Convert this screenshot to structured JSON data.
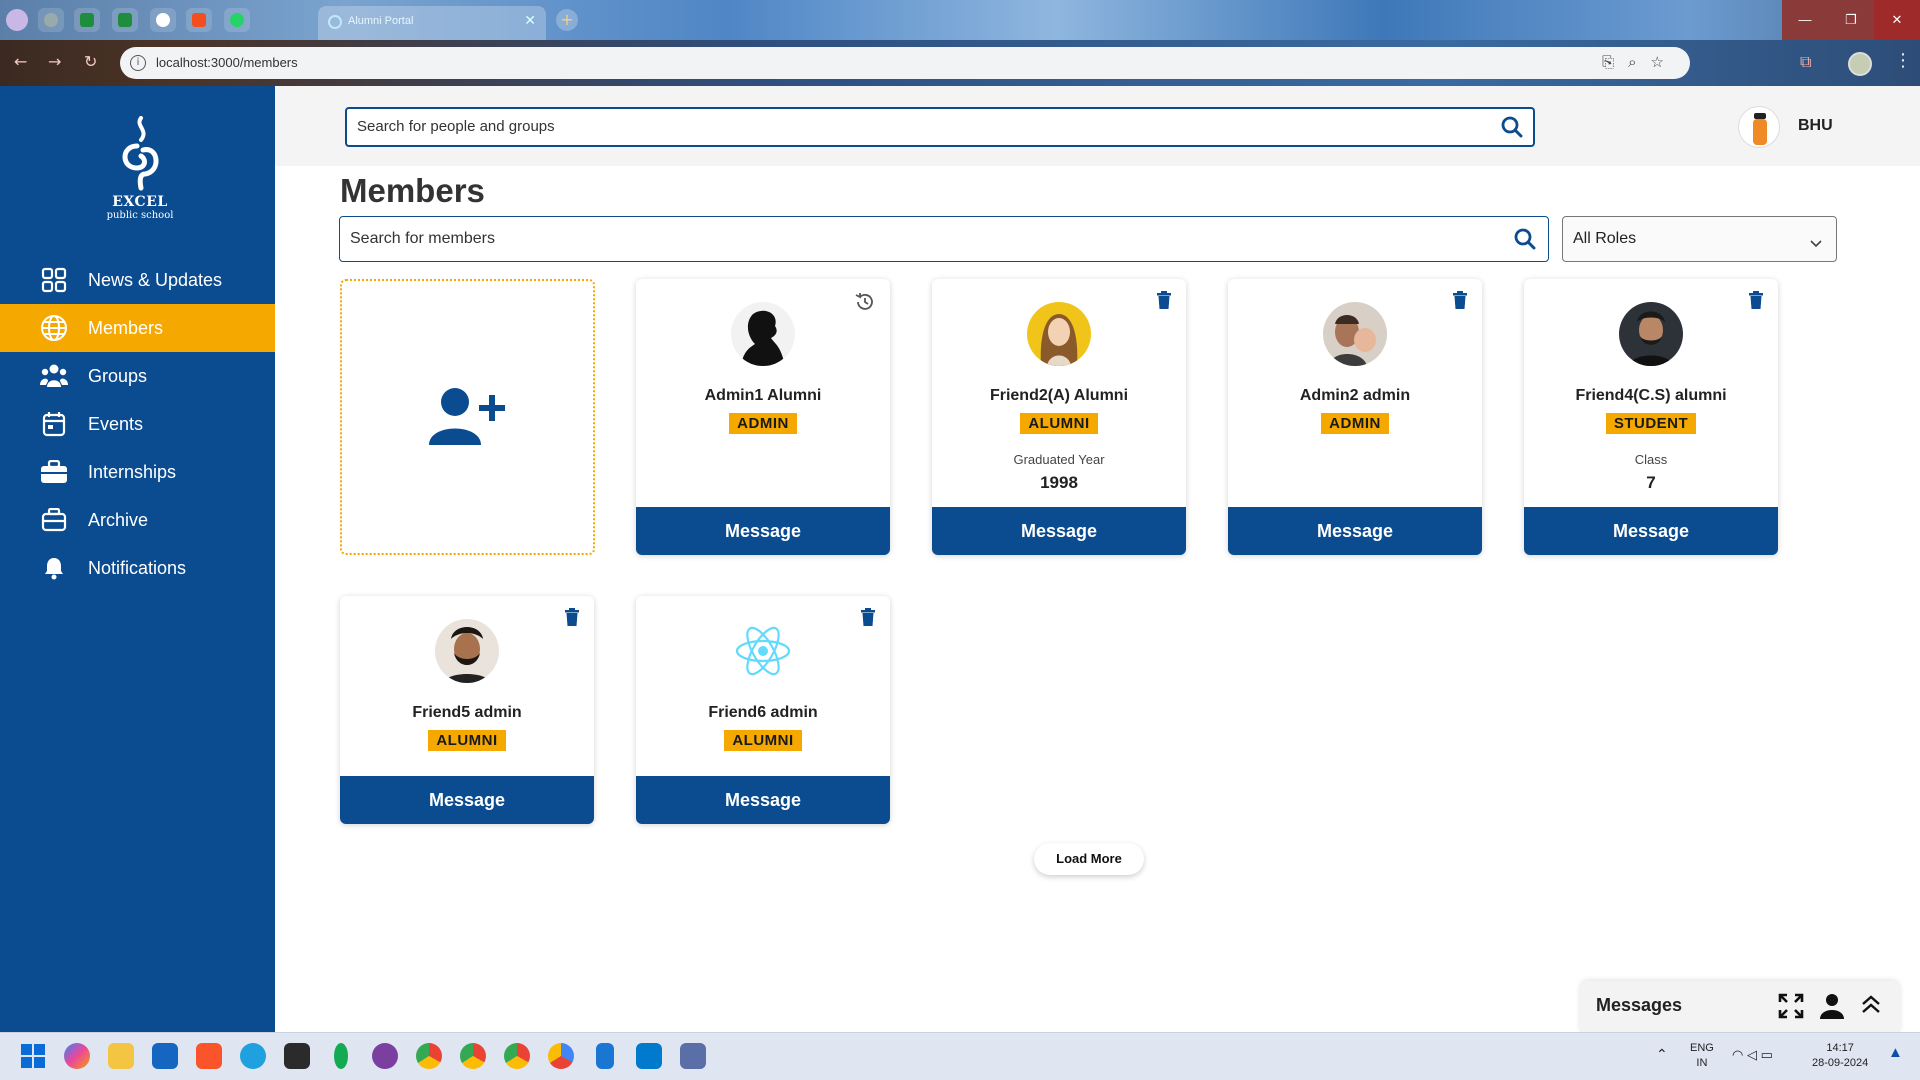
{
  "browser": {
    "tab_title": "Alumni Portal",
    "url": "localhost:3000/members",
    "window_controls": {
      "minimize": "—",
      "maximize": "❐",
      "close": "✕"
    }
  },
  "sidebar": {
    "logo_line1": "EXCEL",
    "logo_line2": "public school",
    "items": [
      {
        "label": "News & Updates",
        "icon": "grid-icon"
      },
      {
        "label": "Members",
        "icon": "globe-icon",
        "active": true
      },
      {
        "label": "Groups",
        "icon": "people-icon"
      },
      {
        "label": "Events",
        "icon": "calendar-icon"
      },
      {
        "label": "Internships",
        "icon": "briefcase-icon"
      },
      {
        "label": "Archive",
        "icon": "archive-icon"
      },
      {
        "label": "Notifications",
        "icon": "bell-icon"
      }
    ]
  },
  "header": {
    "search_placeholder": "Search for people and groups",
    "user_name": "BHU"
  },
  "main": {
    "title": "Members",
    "search_placeholder": "Search for members",
    "role_filter": "All Roles",
    "load_more": "Load More",
    "cards": [
      {
        "name": "Admin1 Alumni",
        "role": "ADMIN",
        "meta_label": "",
        "meta_value": "",
        "button": "Message",
        "corner_icon": "history-icon"
      },
      {
        "name": "Friend2(A) Alumni",
        "role": "ALUMNI",
        "meta_label": "Graduated Year",
        "meta_value": "1998",
        "button": "Message",
        "corner_icon": "trash-icon"
      },
      {
        "name": "Admin2 admin",
        "role": "ADMIN",
        "meta_label": "",
        "meta_value": "",
        "button": "Message",
        "corner_icon": "trash-icon"
      },
      {
        "name": "Friend4(C.S) alumni",
        "role": "STUDENT",
        "meta_label": "Class",
        "meta_value": "7",
        "button": "Message",
        "corner_icon": "trash-icon"
      },
      {
        "name": "Friend5 admin",
        "role": "ALUMNI",
        "meta_label": "",
        "meta_value": "",
        "button": "Message",
        "corner_icon": "trash-icon"
      },
      {
        "name": "Friend6 admin",
        "role": "ALUMNI",
        "meta_label": "",
        "meta_value": "",
        "button": "Message",
        "corner_icon": "trash-icon"
      }
    ]
  },
  "messages_dock": {
    "title": "Messages"
  },
  "taskbar": {
    "lang_line1": "ENG",
    "lang_line2": "IN",
    "time": "14:17",
    "date": "28-09-2024"
  },
  "colors": {
    "primary": "#0b4b8f",
    "accent": "#f5a800",
    "header_bg": "#f4f4f4"
  }
}
